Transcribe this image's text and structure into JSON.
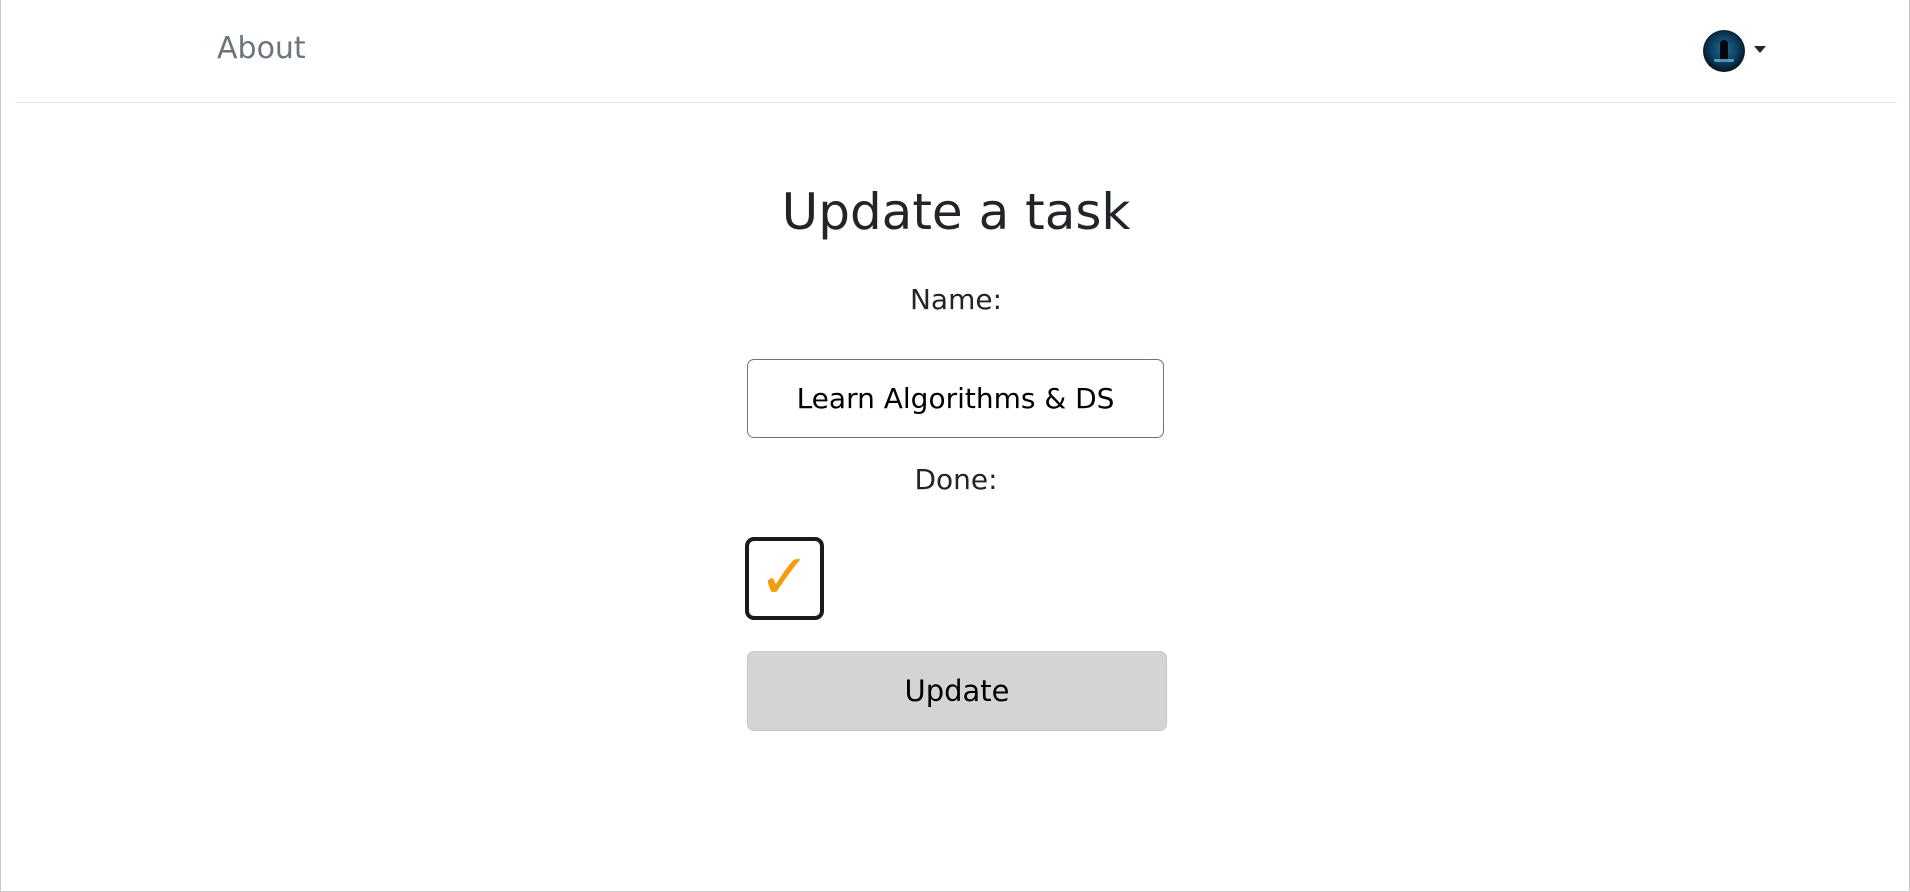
{
  "navbar": {
    "about_label": "About",
    "user_menu": {
      "avatar_icon": "avatar-icon",
      "caret_icon": "caret-down-icon"
    }
  },
  "main": {
    "title": "Update a task",
    "form": {
      "name_label": "Name:",
      "name_value": "Learn Algorithms & DS",
      "done_label": "Done:",
      "done_checked": true,
      "check_glyph": "✓",
      "submit_label": "Update"
    }
  },
  "colors": {
    "check_accent": "#f39c12",
    "button_bg": "#d3d4d5",
    "nav_link": "#6c757d"
  }
}
